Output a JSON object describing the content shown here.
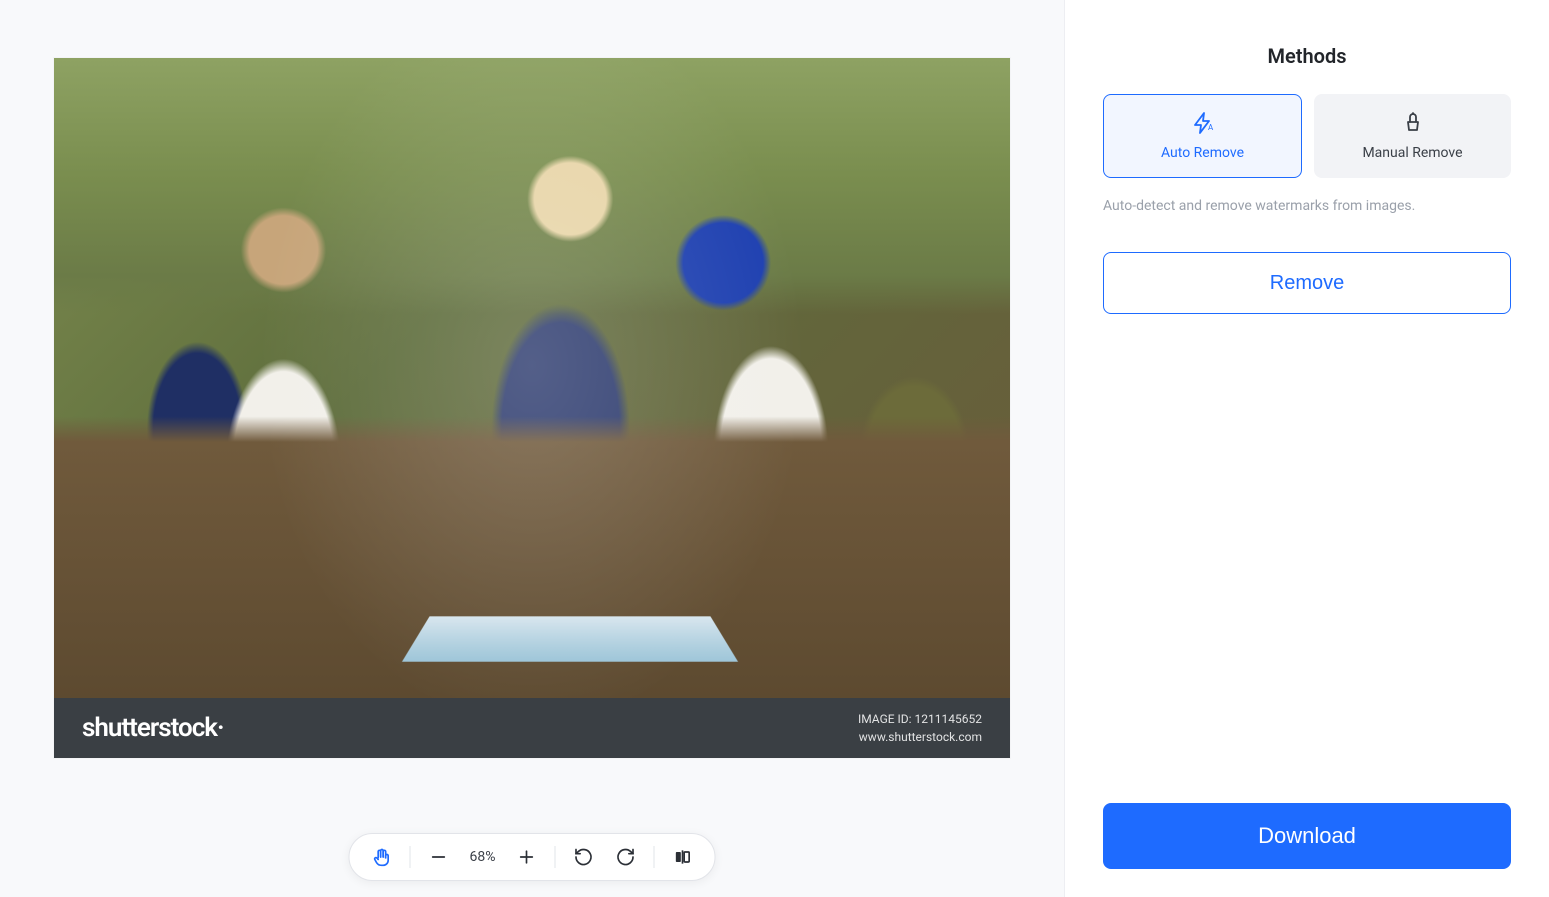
{
  "sidebar": {
    "title": "Methods",
    "methods": [
      {
        "label": "Auto Remove",
        "active": true
      },
      {
        "label": "Manual Remove",
        "active": false
      }
    ],
    "description": "Auto-detect and remove watermarks from images.",
    "remove_label": "Remove",
    "download_label": "Download"
  },
  "toolbar": {
    "zoom": "68%"
  },
  "watermark": {
    "logo": "shutterstock",
    "image_id_line": "IMAGE ID: 1211145652",
    "site_line": "www.shutterstock.com"
  }
}
